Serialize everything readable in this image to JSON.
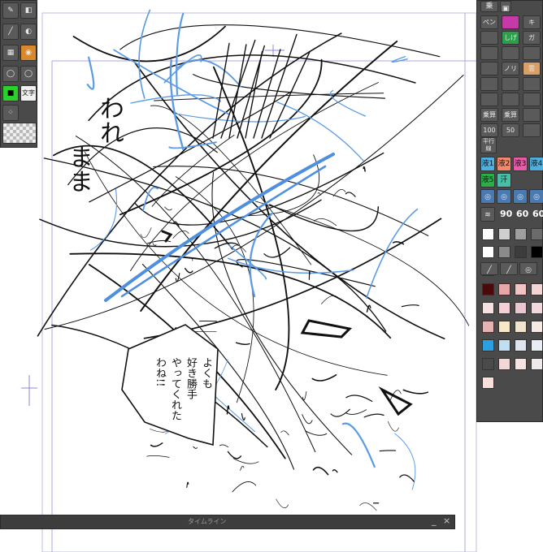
{
  "canvas": {
    "bubble_lines": [
      "よくも",
      "好き勝手",
      "やってくれた",
      "わね!!"
    ],
    "handwritten": [
      "われ",
      "まま"
    ]
  },
  "left_panel": {
    "tools": [
      "pen-icon",
      "eraser-icon",
      "brush-icon",
      "fill-icon",
      "lasso-icon",
      "pattern-icon",
      "text-icon",
      "transparent-icon"
    ],
    "text_tool_label": "文字"
  },
  "right_panel": {
    "header_label": "乗",
    "rows": [
      [
        "ペン",
        "",
        "キ"
      ],
      [
        "",
        "しげ",
        "ガ"
      ],
      [
        "",
        "",
        ""
      ],
      [
        "",
        "ノリ",
        "雲"
      ],
      [
        "",
        "",
        ""
      ],
      [
        "",
        "",
        ""
      ],
      [
        "乗算",
        "乗算",
        ""
      ],
      [
        "100",
        "50",
        ""
      ]
    ],
    "multiply_labels": [
      "乗算 100",
      "乗算 50"
    ],
    "parallel_label": "平行線",
    "liquid_labels": [
      "液1",
      "液2",
      "液3",
      "液4",
      "液5",
      "汗"
    ],
    "sizes": [
      "90",
      "60",
      "60"
    ],
    "colors_gray": [
      "#ffffff",
      "#cfcfcf",
      "#9e9e9e",
      "#6b6b6b",
      "#ffffff",
      "#8a8a8a",
      "#3c3c3c",
      "#000000",
      "#e8133b"
    ],
    "colors_skin": [
      "#4a0a0a",
      "#e6a7a7",
      "#f0c4c4",
      "#f2d6d6",
      "#f6e0e0",
      "#f4d0d6",
      "#e9c6d0",
      "#f1d8dc",
      "#e6b3b3",
      "#f6e8c8",
      "#f0e4d0",
      "#f5eae4",
      "#2aa0e0",
      "#c2dff2",
      "#dde6ef",
      "#e8eef3",
      "#4a4a4a",
      "#f0d8d8",
      "#f6e4e4",
      "#eeeaea",
      "#fbe0dc"
    ]
  },
  "timeline": {
    "title": "タイムライン",
    "minimize": "_",
    "close": "×"
  }
}
